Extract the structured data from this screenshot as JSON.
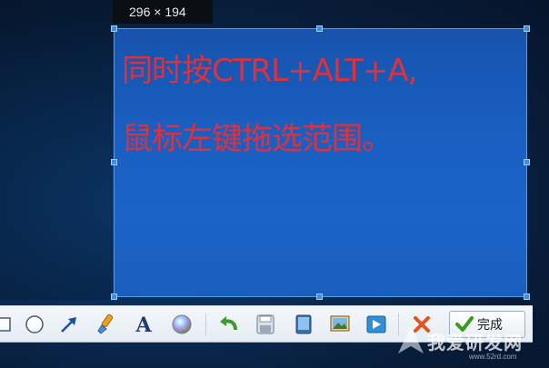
{
  "size_label": "296 × 194",
  "selection": {
    "line1": "同时按CTRL+ALT+A,",
    "line2": "鼠标左键拖选范围。"
  },
  "toolbar": {
    "tools": [
      {
        "name": "rectangle-tool",
        "icon": "rectangle-icon"
      },
      {
        "name": "ellipse-tool",
        "icon": "ellipse-icon"
      },
      {
        "name": "arrow-tool",
        "icon": "arrow-icon"
      },
      {
        "name": "brush-tool",
        "icon": "brush-icon"
      },
      {
        "name": "text-tool",
        "icon": "text-icon",
        "label": "A"
      },
      {
        "name": "color-tool",
        "icon": "color-icon"
      },
      {
        "name": "undo-tool",
        "icon": "undo-icon"
      },
      {
        "name": "save-tool",
        "icon": "save-icon"
      },
      {
        "name": "tablet-tool",
        "icon": "tablet-icon"
      },
      {
        "name": "image-tool",
        "icon": "image-icon"
      },
      {
        "name": "send-tool",
        "icon": "send-icon"
      },
      {
        "name": "cancel-tool",
        "icon": "cancel-icon"
      }
    ],
    "finish_label": "完成"
  },
  "watermark": {
    "title": "我爱研发网",
    "url": "www.52rd.com"
  },
  "colors": {
    "selection_text": "#e0303c",
    "selection_fill": "#1a5fc1",
    "handle": "#3d8fe0"
  }
}
